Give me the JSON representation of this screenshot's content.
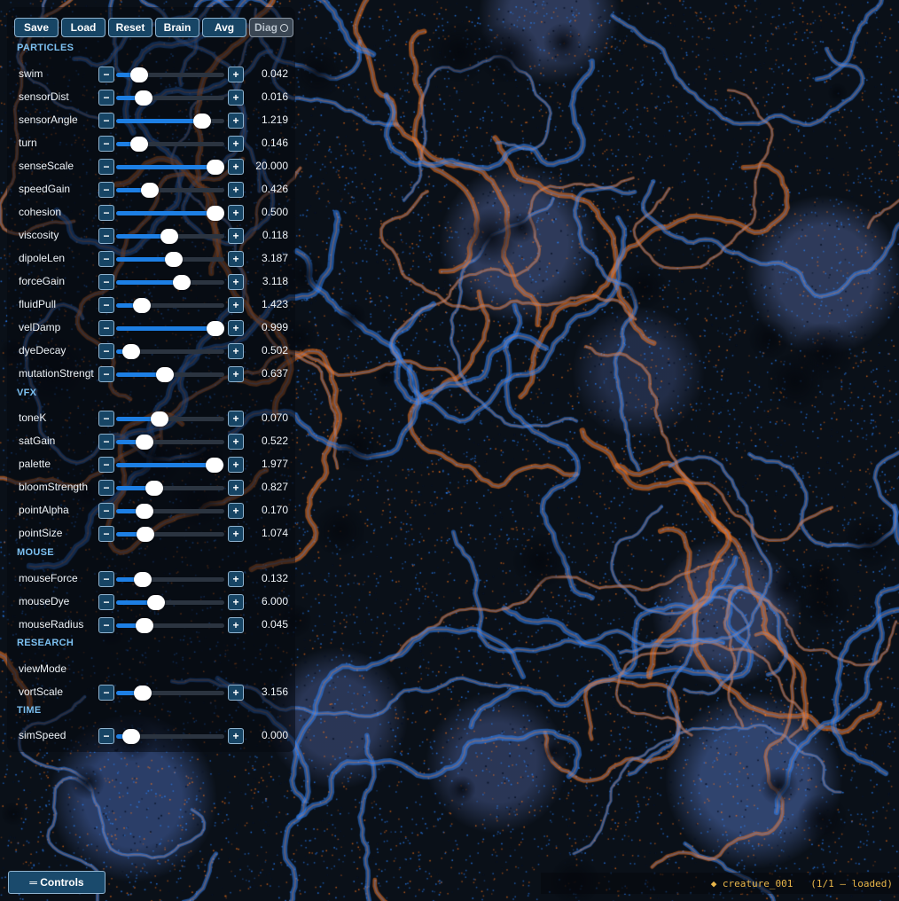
{
  "toolbar": {
    "buttons": [
      "Save",
      "Load",
      "Reset",
      "Brain",
      "Avg"
    ],
    "diag_label": "Diag"
  },
  "sections": [
    {
      "title": "PARTICLES",
      "params": [
        {
          "name": "swim",
          "value": "0.042",
          "level": 0.16
        },
        {
          "name": "sensorDist",
          "value": "0.016",
          "level": 0.21
        },
        {
          "name": "sensorAngle",
          "value": "1.219",
          "level": 0.85
        },
        {
          "name": "turn",
          "value": "0.146",
          "level": 0.16
        },
        {
          "name": "senseScale",
          "value": "20.000",
          "level": 1.0
        },
        {
          "name": "speedGain",
          "value": "0.426",
          "level": 0.27
        },
        {
          "name": "cohesion",
          "value": "0.500",
          "level": 1.0
        },
        {
          "name": "viscosity",
          "value": "0.118",
          "level": 0.49
        },
        {
          "name": "dipoleLen",
          "value": "3.187",
          "level": 0.54
        },
        {
          "name": "forceGain",
          "value": "3.118",
          "level": 0.63
        },
        {
          "name": "fluidPull",
          "value": "1.423",
          "level": 0.19
        },
        {
          "name": "velDamp",
          "value": "0.999",
          "level": 1.0
        },
        {
          "name": "dyeDecay",
          "value": "0.502",
          "level": 0.07
        },
        {
          "name": "mutationStrengt",
          "value": "0.637",
          "level": 0.44
        }
      ]
    },
    {
      "title": "VFX",
      "params": [
        {
          "name": "toneK",
          "value": "0.070",
          "level": 0.38
        },
        {
          "name": "satGain",
          "value": "0.522",
          "level": 0.22
        },
        {
          "name": "palette",
          "value": "1.977",
          "level": 0.99
        },
        {
          "name": "bloomStrength",
          "value": "0.827",
          "level": 0.32
        },
        {
          "name": "pointAlpha",
          "value": "0.170",
          "level": 0.22
        },
        {
          "name": "pointSize",
          "value": "1.074",
          "level": 0.23
        }
      ]
    },
    {
      "title": "MOUSE",
      "params": [
        {
          "name": "mouseForce",
          "value": "0.132",
          "level": 0.2
        },
        {
          "name": "mouseDye",
          "value": "6.000",
          "level": 0.34
        },
        {
          "name": "mouseRadius",
          "value": "0.045",
          "level": 0.22
        }
      ]
    },
    {
      "title": "RESEARCH",
      "params": [
        {
          "name": "viewMode",
          "value": null,
          "level": null
        },
        {
          "name": "vortScale",
          "value": "3.156",
          "level": 0.2
        }
      ]
    },
    {
      "title": "TIME",
      "params": [
        {
          "name": "simSpeed",
          "value": "0.000",
          "level": 0.07
        }
      ]
    }
  ],
  "controls_button": "═ Controls",
  "status": {
    "icon": "diamond-icon",
    "text": "◆ creature_001   (1/1 — loaded)"
  },
  "colors": {
    "orange": "#ff7a1f",
    "blue": "#2f86ff",
    "slider_fill": "#1d7fe4",
    "section": "#7cc0f0",
    "status": "#e8b64a"
  }
}
